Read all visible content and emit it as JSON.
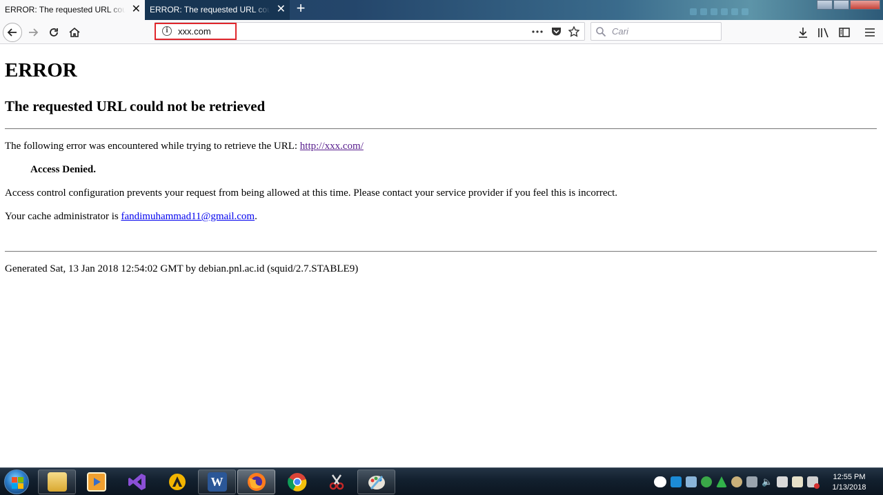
{
  "tabs": [
    {
      "title": "ERROR: The requested URL could not be retrieved",
      "active": true
    },
    {
      "title": "ERROR: The requested URL could not be retrieved",
      "active": false
    }
  ],
  "urlbar": {
    "url": "xxx.com"
  },
  "searchbar": {
    "placeholder": "Cari"
  },
  "page": {
    "heading": "ERROR",
    "subheading": "The requested URL could not be retrieved",
    "error_prefix": "The following error was encountered while trying to retrieve the URL: ",
    "error_url": "http://xxx.com/",
    "denied": "Access Denied.",
    "access_text": "Access control configuration prevents your request from being allowed at this time. Please contact your service provider if you feel this is incorrect.",
    "admin_prefix": "Your cache administrator is ",
    "admin_email": "fandimuhammad11@gmail.com",
    "admin_suffix": ".",
    "generated": "Generated Sat, 13 Jan 2018 12:54:02 GMT by debian.pnl.ac.id (squid/2.7.STABLE9)"
  },
  "taskbar": {
    "apps": [
      {
        "name": "file-explorer-icon",
        "color": "#e8c25a"
      },
      {
        "name": "media-player-icon",
        "color": "#f0a030"
      },
      {
        "name": "visual-studio-icon",
        "color": "#8a4fd6"
      },
      {
        "name": "autocad-icon",
        "color": "#f2b400"
      },
      {
        "name": "word-icon",
        "color": "#2b5797"
      },
      {
        "name": "firefox-icon",
        "color": "#ff7b1c"
      },
      {
        "name": "chrome-icon",
        "color": "#db4437"
      },
      {
        "name": "snipping-tool-icon",
        "color": "#c62828"
      },
      {
        "name": "paint-icon",
        "color": "#6ab0de"
      }
    ],
    "clock_time": "12:55 PM",
    "clock_date": "1/13/2018"
  },
  "colors": {
    "visited_link": "#551a8b",
    "link": "#0000ee",
    "url_highlight": "#e0262c"
  }
}
